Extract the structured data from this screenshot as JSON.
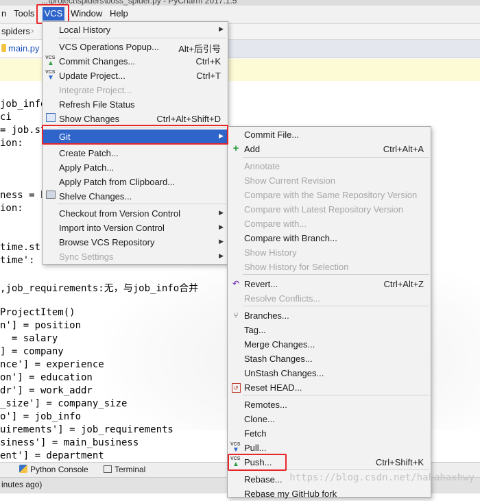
{
  "window_title": "...\\project\\spiders\\boss_spider.py - PyCharm 2017.1.5",
  "menubar": {
    "partial_prev": "n",
    "tools": "Tools",
    "vcs": "VCS",
    "window": "Window",
    "help": "Help"
  },
  "breadcrumb": {
    "spiders": "spiders"
  },
  "file_tab": "main.py",
  "editor_lines": [
    "job_info",
    "ci",
    "= job.st",
    "ion:",
    "",
    "",
    "ness = h",
    "ion:",
    "",
    "",
    "time.st",
    "time':",
    "",
    ",job_requirements:无，与job_info合并",
    "",
    "ProjectItem()",
    "n'] = position",
    "  = salary",
    "] = company",
    "nce'] = experience",
    "on'] = education",
    "dr'] = work_addr",
    "_size'] = company_size",
    "o'] = job_info",
    "uirements'] = job_requirements",
    "siness'] = main_business",
    "ent'] = department"
  ],
  "bottom_tabs": {
    "python_console": "Python Console",
    "terminal": "Terminal"
  },
  "status_text": "inutes ago)",
  "watermark": "https://blog.csdn.net/hahahaxhwy",
  "vcs_menu": {
    "items": [
      {
        "label": "Local History",
        "submenu": true
      },
      {
        "label": "VCS Operations Popup...",
        "shortcut": "Alt+后引号"
      },
      {
        "label": "Commit Changes...",
        "shortcut": "Ctrl+K"
      },
      {
        "label": "Update Project...",
        "shortcut": "Ctrl+T"
      },
      {
        "label": "Integrate Project...",
        "disabled": true
      },
      {
        "label": "Refresh File Status"
      },
      {
        "label": "Show Changes",
        "shortcut": "Ctrl+Alt+Shift+D"
      },
      {
        "label": "Git",
        "submenu": true,
        "selected": true
      },
      {
        "label": "Create Patch..."
      },
      {
        "label": "Apply Patch..."
      },
      {
        "label": "Apply Patch from Clipboard..."
      },
      {
        "label": "Shelve Changes..."
      },
      {
        "label": "Checkout from Version Control",
        "submenu": true
      },
      {
        "label": "Import into Version Control",
        "submenu": true
      },
      {
        "label": "Browse VCS Repository",
        "submenu": true
      },
      {
        "label": "Sync Settings",
        "submenu": true,
        "disabled": true
      }
    ]
  },
  "git_menu": {
    "items": [
      {
        "label": "Commit File..."
      },
      {
        "label": "Add",
        "shortcut": "Ctrl+Alt+A"
      },
      {
        "label": "Annotate",
        "disabled": true
      },
      {
        "label": "Show Current Revision",
        "disabled": true
      },
      {
        "label": "Compare with the Same Repository Version",
        "disabled": true
      },
      {
        "label": "Compare with Latest Repository Version",
        "disabled": true
      },
      {
        "label": "Compare with...",
        "disabled": true
      },
      {
        "label": "Compare with Branch..."
      },
      {
        "label": "Show History",
        "disabled": true
      },
      {
        "label": "Show History for Selection",
        "disabled": true
      },
      {
        "label": "Revert...",
        "shortcut": "Ctrl+Alt+Z"
      },
      {
        "label": "Resolve Conflicts...",
        "disabled": true
      },
      {
        "label": "Branches..."
      },
      {
        "label": "Tag..."
      },
      {
        "label": "Merge Changes..."
      },
      {
        "label": "Stash Changes..."
      },
      {
        "label": "UnStash Changes..."
      },
      {
        "label": "Reset HEAD..."
      },
      {
        "label": "Remotes..."
      },
      {
        "label": "Clone..."
      },
      {
        "label": "Fetch"
      },
      {
        "label": "Pull..."
      },
      {
        "label": "Push...",
        "shortcut": "Ctrl+Shift+K"
      },
      {
        "label": "Rebase..."
      },
      {
        "label": "Rebase my GitHub fork"
      }
    ]
  }
}
